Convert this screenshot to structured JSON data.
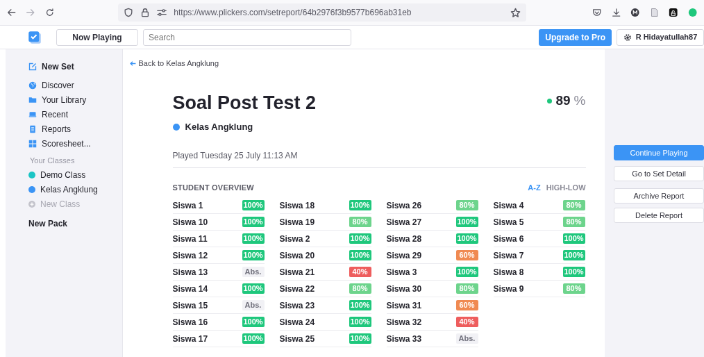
{
  "browser": {
    "url": "https://www.plickers.com/setreport/64b2976f3b9577b696ab31eb"
  },
  "header": {
    "now_playing": "Now Playing",
    "search": {
      "placeholder": "Search"
    },
    "upgrade": "Upgrade to Pro",
    "user": "R Hidayatullah87"
  },
  "sidebar": {
    "new_set": "New Set",
    "items": [
      {
        "label": "Discover",
        "kind": "globe"
      },
      {
        "label": "Your Library",
        "kind": "folder"
      },
      {
        "label": "Recent",
        "kind": "recent"
      },
      {
        "label": "Reports",
        "kind": "report"
      },
      {
        "label": "Scoresheet...",
        "kind": "grid"
      }
    ],
    "classes_heading": "Your Classes",
    "classes": [
      {
        "label": "Demo Class",
        "color": "#1cc5c5",
        "disabled": false
      },
      {
        "label": "Kelas Angklung",
        "color": "#3b94f5",
        "disabled": false
      },
      {
        "label": "New Class",
        "color": "#c4c4cc",
        "disabled": true
      }
    ],
    "new_pack": "New Pack"
  },
  "back_link": "Back to Kelas Angklung",
  "report": {
    "title": "Soal Post Test 2",
    "score": "89",
    "percent": "%",
    "class": {
      "name": "Kelas Angklung",
      "color": "#3b94f5"
    },
    "played": "Played Tuesday 25 July 11:13 AM"
  },
  "overview": {
    "heading": "STUDENT OVERVIEW",
    "sorts": [
      {
        "label": "A-Z",
        "selected": true
      },
      {
        "label": "HIGH-LOW",
        "selected": false
      }
    ],
    "columns": [
      [
        {
          "name": "Siswa 1",
          "score": "100%",
          "color": "#1ec77c"
        },
        {
          "name": "Siswa 10",
          "score": "100%",
          "color": "#1ec77c"
        },
        {
          "name": "Siswa 11",
          "score": "100%",
          "color": "#1ec77c"
        },
        {
          "name": "Siswa 12",
          "score": "100%",
          "color": "#1ec77c"
        },
        {
          "name": "Siswa 13",
          "score": "Abs.",
          "color": "#f1f1f5"
        },
        {
          "name": "Siswa 14",
          "score": "100%",
          "color": "#1ec77c"
        },
        {
          "name": "Siswa 15",
          "score": "Abs.",
          "color": "#f1f1f5"
        },
        {
          "name": "Siswa 16",
          "score": "100%",
          "color": "#1ec77c"
        },
        {
          "name": "Siswa 17",
          "score": "100%",
          "color": "#1ec77c"
        }
      ],
      [
        {
          "name": "Siswa 18",
          "score": "100%",
          "color": "#1ec77c"
        },
        {
          "name": "Siswa 19",
          "score": "80%",
          "color": "#6dd48c"
        },
        {
          "name": "Siswa 2",
          "score": "100%",
          "color": "#1ec77c"
        },
        {
          "name": "Siswa 20",
          "score": "100%",
          "color": "#1ec77c"
        },
        {
          "name": "Siswa 21",
          "score": "40%",
          "color": "#ee5d5d"
        },
        {
          "name": "Siswa 22",
          "score": "80%",
          "color": "#6dd48c"
        },
        {
          "name": "Siswa 23",
          "score": "100%",
          "color": "#1ec77c"
        },
        {
          "name": "Siswa 24",
          "score": "100%",
          "color": "#1ec77c"
        },
        {
          "name": "Siswa 25",
          "score": "100%",
          "color": "#1ec77c"
        }
      ],
      [
        {
          "name": "Siswa 26",
          "score": "80%",
          "color": "#6dd48c"
        },
        {
          "name": "Siswa 27",
          "score": "100%",
          "color": "#1ec77c"
        },
        {
          "name": "Siswa 28",
          "score": "100%",
          "color": "#1ec77c"
        },
        {
          "name": "Siswa 29",
          "score": "60%",
          "color": "#f08a52"
        },
        {
          "name": "Siswa 3",
          "score": "100%",
          "color": "#1ec77c"
        },
        {
          "name": "Siswa 30",
          "score": "80%",
          "color": "#6dd48c"
        },
        {
          "name": "Siswa 31",
          "score": "60%",
          "color": "#f08a52"
        },
        {
          "name": "Siswa 32",
          "score": "40%",
          "color": "#ee5d5d"
        },
        {
          "name": "Siswa 33",
          "score": "Abs.",
          "color": "#f1f1f5"
        }
      ],
      [
        {
          "name": "Siswa 4",
          "score": "80%",
          "color": "#6dd48c"
        },
        {
          "name": "Siswa 5",
          "score": "80%",
          "color": "#6dd48c"
        },
        {
          "name": "Siswa 6",
          "score": "100%",
          "color": "#1ec77c"
        },
        {
          "name": "Siswa 7",
          "score": "100%",
          "color": "#1ec77c"
        },
        {
          "name": "Siswa 8",
          "score": "100%",
          "color": "#1ec77c"
        },
        {
          "name": "Siswa 9",
          "score": "80%",
          "color": "#6dd48c"
        }
      ]
    ]
  },
  "actions": [
    {
      "label": "Continue Playing",
      "kind": "primary"
    },
    {
      "label": "Go to Set Detail",
      "kind": "default"
    },
    {
      "label": "Archive Report",
      "kind": "default"
    },
    {
      "label": "Delete Report",
      "kind": "default"
    }
  ]
}
